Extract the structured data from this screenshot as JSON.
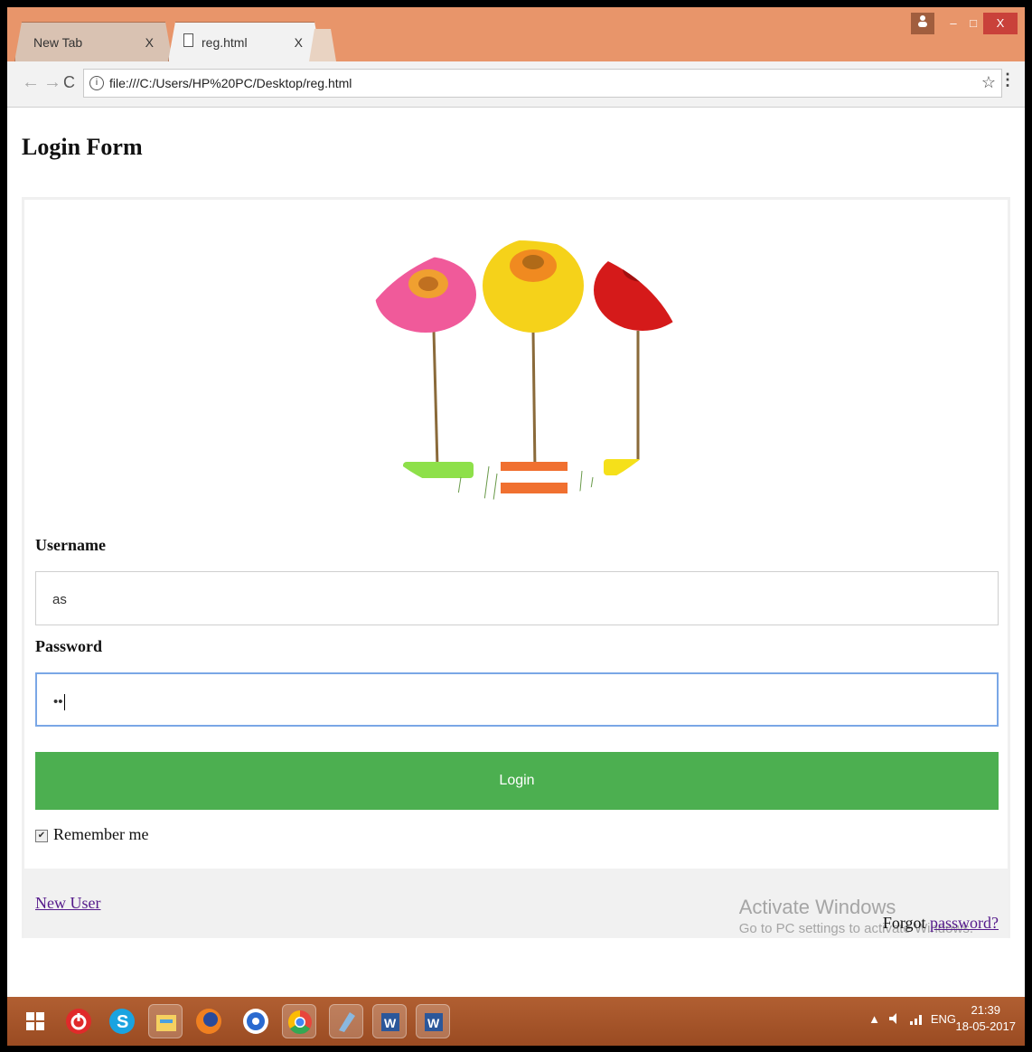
{
  "browser": {
    "tabs": [
      {
        "label": "New Tab",
        "close": "X"
      },
      {
        "label": "reg.html",
        "close": "X"
      }
    ],
    "window_controls": {
      "minimize": "–",
      "maximize": "□",
      "close": "X"
    },
    "url": "file:///C:/Users/HP%20PC/Desktop/reg.html",
    "star_icon": "☆",
    "menu_icon": "⋮"
  },
  "page": {
    "title": "Login Form",
    "username_label": "Username",
    "username_value": "as",
    "password_label": "Password",
    "password_value": "••",
    "login_button": "Login",
    "remember_label": "Remember me",
    "remember_checked": true,
    "new_user_link": "New User",
    "forgot_text": "Forgot ",
    "forgot_link": "password?"
  },
  "watermark": {
    "line1": "Activate Windows",
    "line2": "Go to PC settings to activate Windows."
  },
  "taskbar": {
    "icons": [
      "windows-start-icon",
      "power-icon",
      "skype-icon",
      "file-explorer-icon",
      "firefox-icon",
      "media-icon",
      "chrome-icon",
      "app-icon",
      "word-icon",
      "word-icon-2"
    ],
    "lang": "ENG",
    "time": "21:39",
    "date": "18-05-2017"
  },
  "colors": {
    "titlebar": "#e8956a",
    "login_button": "#4caf50",
    "taskbar": "#a8552a",
    "link": "#551a8b"
  }
}
